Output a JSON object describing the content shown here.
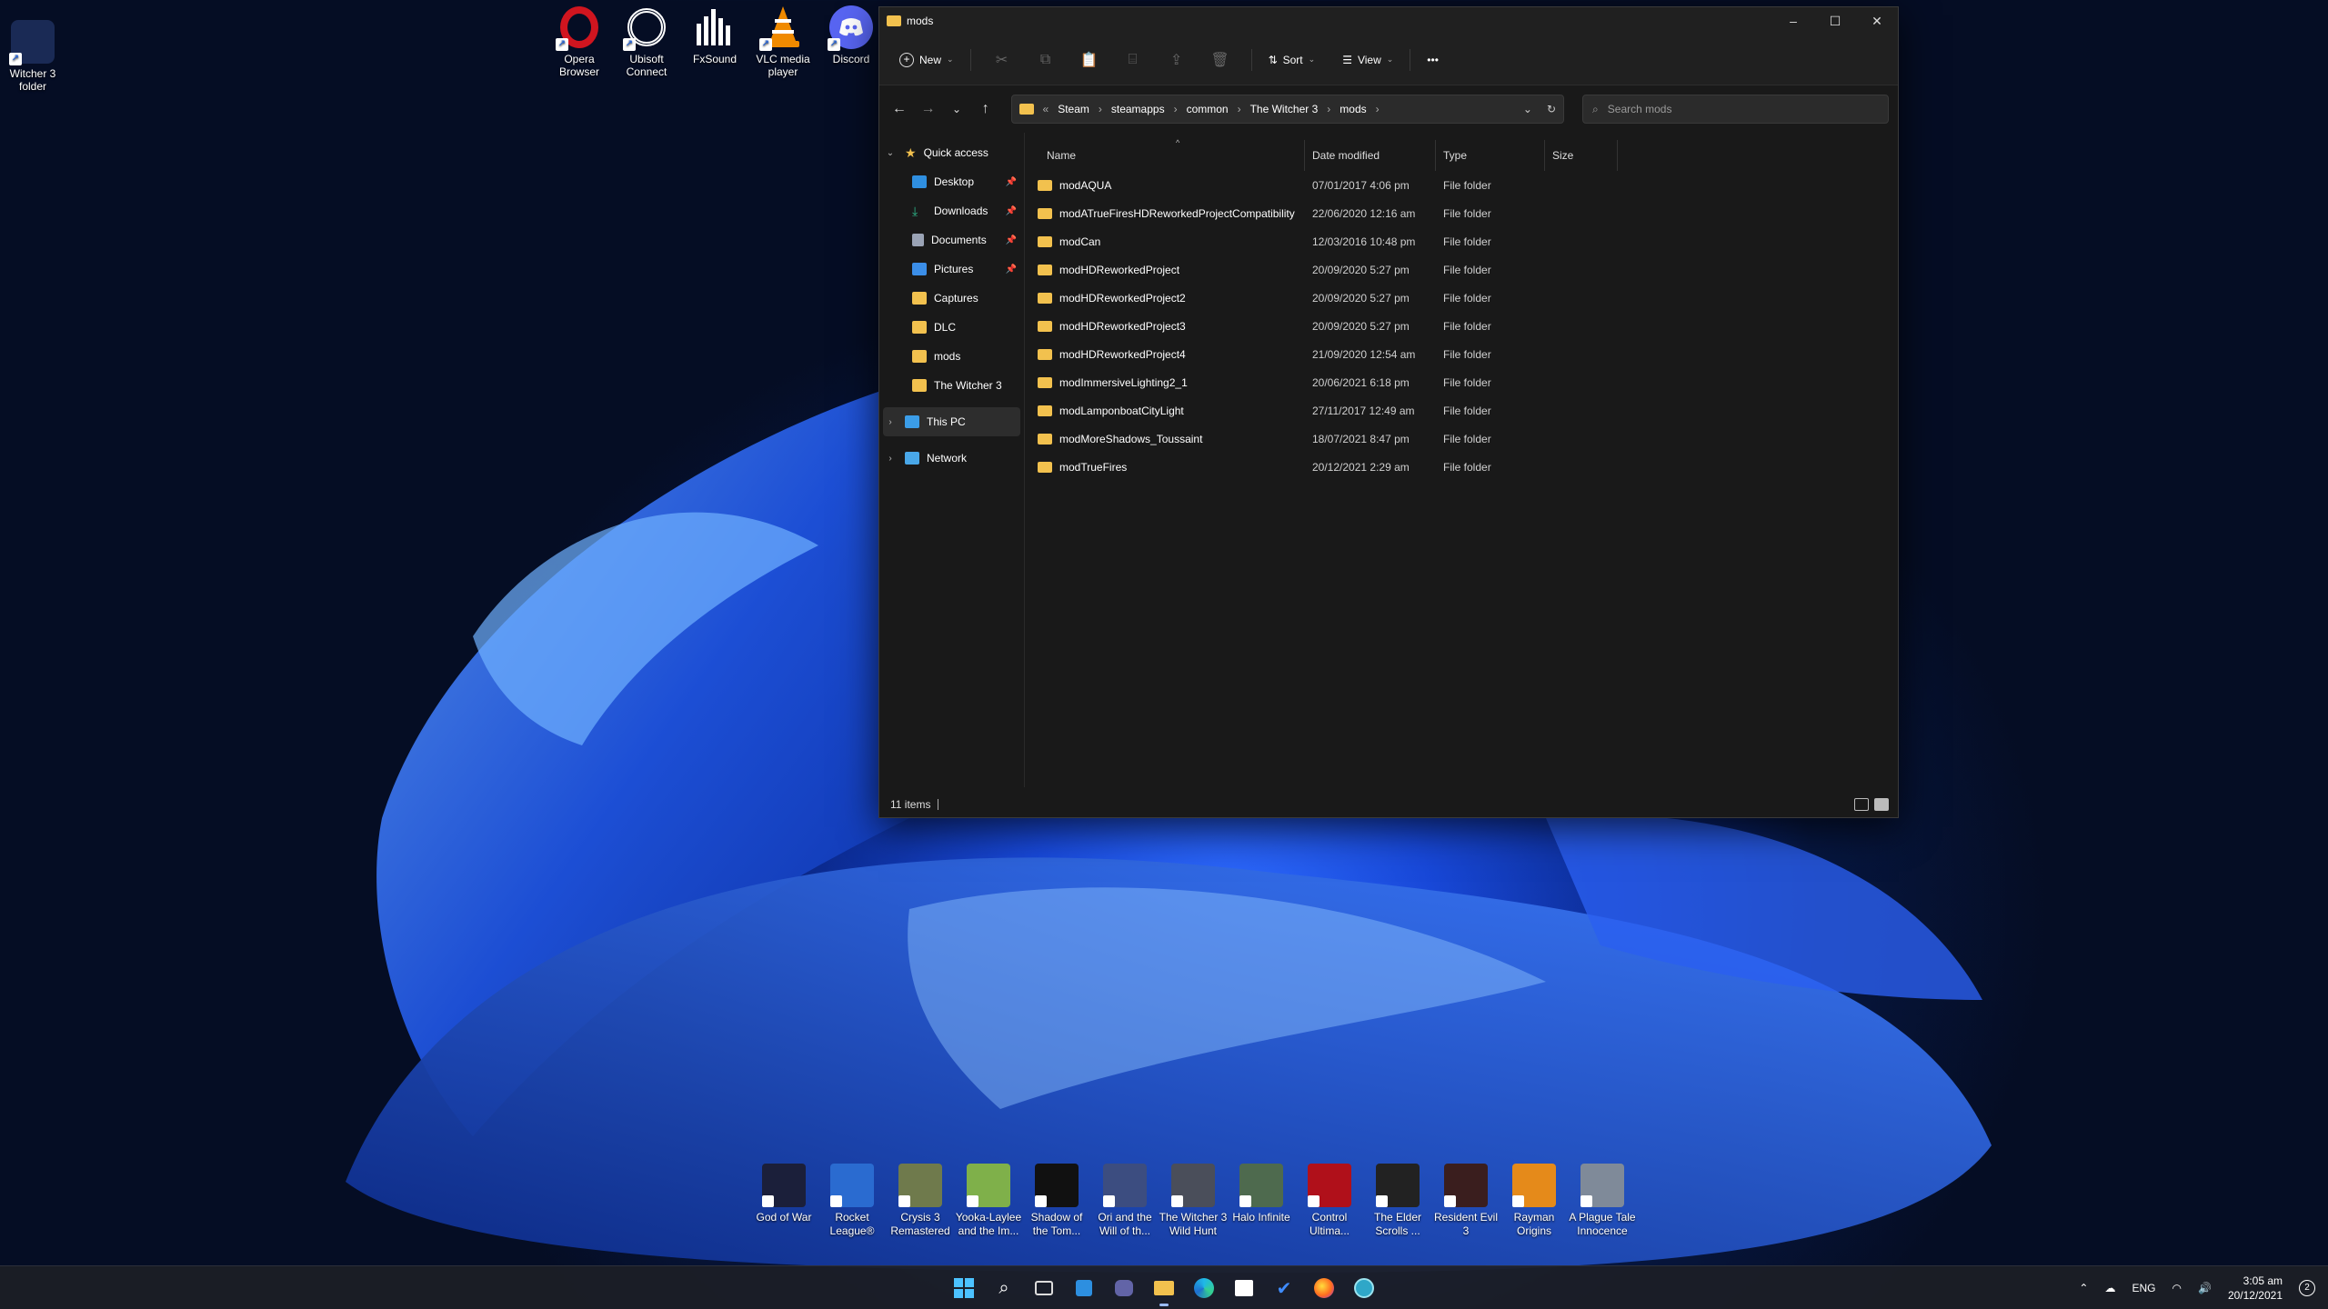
{
  "desktop": {
    "top_icons": [
      {
        "label": "Witcher 3 folder",
        "color": "#1a2a55"
      },
      {
        "label": "Opera Browser",
        "color": "#d0151f"
      },
      {
        "label": "Ubisoft Connect",
        "color": "#1b1b1b"
      },
      {
        "label": "FxSound",
        "color": "#101010"
      },
      {
        "label": "VLC media player",
        "color": "#f08a00"
      },
      {
        "label": "Discord",
        "color": "#5865f2"
      }
    ],
    "game_icons": [
      {
        "label": "God of War",
        "color": "#1b1f3a"
      },
      {
        "label": "Rocket League®",
        "color": "#2a6bd0"
      },
      {
        "label": "Crysis 3 Remastered",
        "color": "#6f7a4c"
      },
      {
        "label": "Yooka-Laylee and the Im...",
        "color": "#7fb04a"
      },
      {
        "label": "Shadow of the Tom...",
        "color": "#111111"
      },
      {
        "label": "Ori and the Will of th...",
        "color": "#3c4d80"
      },
      {
        "label": "The Witcher 3 Wild Hunt",
        "color": "#4a4e5a"
      },
      {
        "label": "Halo Infinite",
        "color": "#4e6a4e"
      },
      {
        "label": "Control Ultima...",
        "color": "#b0101a"
      },
      {
        "label": "The Elder Scrolls ...",
        "color": "#222222"
      },
      {
        "label": "Resident Evil 3",
        "color": "#3a1e1e"
      },
      {
        "label": "Rayman Origins",
        "color": "#e58a1a"
      },
      {
        "label": "A Plague Tale Innocence",
        "color": "#7f8a99"
      }
    ]
  },
  "window": {
    "title": "mods",
    "commands": {
      "new": "New",
      "sort": "Sort",
      "view": "View",
      "more": "•••"
    },
    "breadcrumb": [
      "Steam",
      "steamapps",
      "common",
      "The Witcher 3",
      "mods"
    ],
    "search_placeholder": "Search mods",
    "sidebar": {
      "quick_access": "Quick access",
      "items": [
        {
          "label": "Desktop",
          "pinned": true,
          "color": "#2f8fe0"
        },
        {
          "label": "Downloads",
          "pinned": true,
          "color": "#2eb88a"
        },
        {
          "label": "Documents",
          "pinned": true,
          "color": "#9aa3b5"
        },
        {
          "label": "Pictures",
          "pinned": true,
          "color": "#3b8ee8"
        },
        {
          "label": "Captures",
          "pinned": false,
          "color": "#f2c14e"
        },
        {
          "label": "DLC",
          "pinned": false,
          "color": "#f2c14e"
        },
        {
          "label": "mods",
          "pinned": false,
          "color": "#f2c14e"
        },
        {
          "label": "The Witcher 3",
          "pinned": false,
          "color": "#f2c14e"
        }
      ],
      "this_pc": "This PC",
      "network": "Network"
    },
    "columns": {
      "name": "Name",
      "date": "Date modified",
      "type": "Type",
      "size": "Size"
    },
    "files": [
      {
        "name": "modAQUA",
        "date": "07/01/2017 4:06 pm",
        "type": "File folder"
      },
      {
        "name": "modATrueFiresHDReworkedProjectCompatibility",
        "date": "22/06/2020 12:16 am",
        "type": "File folder"
      },
      {
        "name": "modCan",
        "date": "12/03/2016 10:48 pm",
        "type": "File folder"
      },
      {
        "name": "modHDReworkedProject",
        "date": "20/09/2020 5:27 pm",
        "type": "File folder"
      },
      {
        "name": "modHDReworkedProject2",
        "date": "20/09/2020 5:27 pm",
        "type": "File folder"
      },
      {
        "name": "modHDReworkedProject3",
        "date": "20/09/2020 5:27 pm",
        "type": "File folder"
      },
      {
        "name": "modHDReworkedProject4",
        "date": "21/09/2020 12:54 am",
        "type": "File folder"
      },
      {
        "name": "modImmersiveLighting2_1",
        "date": "20/06/2021 6:18 pm",
        "type": "File folder"
      },
      {
        "name": "modLamponboatCityLight",
        "date": "27/11/2017 12:49 am",
        "type": "File folder"
      },
      {
        "name": "modMoreShadows_Toussaint",
        "date": "18/07/2021 8:47 pm",
        "type": "File folder"
      },
      {
        "name": "modTrueFires",
        "date": "20/12/2021 2:29 am",
        "type": "File folder"
      }
    ],
    "status": "11 items"
  },
  "taskbar": {
    "language": "ENG",
    "time": "3:05 am",
    "date": "20/12/2021",
    "notifications": "2"
  }
}
